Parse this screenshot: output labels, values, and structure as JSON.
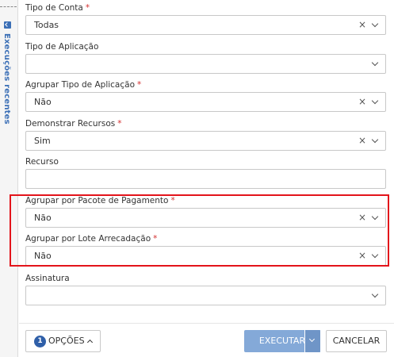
{
  "side_panel": {
    "label": "Execuções recentes"
  },
  "fields": [
    {
      "label": "Tipo de Conta",
      "required": "*",
      "value": "Todas"
    },
    {
      "label": "Tipo de Aplicação",
      "required": "",
      "value": ""
    },
    {
      "label": "Agrupar Tipo de Aplicação",
      "required": "*",
      "value": "Não"
    },
    {
      "label": "Demonstrar Recursos",
      "required": "*",
      "value": "Sim"
    },
    {
      "label": "Recurso",
      "required": "",
      "value": ""
    },
    {
      "label": "Agrupar por Pacote de Pagamento",
      "required": "*",
      "value": "Não"
    },
    {
      "label": "Agrupar por Lote Arrecadação",
      "required": "*",
      "value": "Não"
    },
    {
      "label": "Assinatura",
      "required": "",
      "value": ""
    }
  ],
  "footer": {
    "options_count": "1",
    "options_label": "OPÇÕES",
    "execute_label": "EXECUTAR",
    "cancel_label": "CANCELAR"
  },
  "colors": {
    "accent": "#2f5fa8",
    "execute": "#84a9d8",
    "required": "#d32f2f",
    "highlight": "#e3141b"
  },
  "icons": {
    "clear": "close-icon",
    "dropdown": "chevron-down-icon",
    "options_toggle": "chevron-up-icon"
  }
}
